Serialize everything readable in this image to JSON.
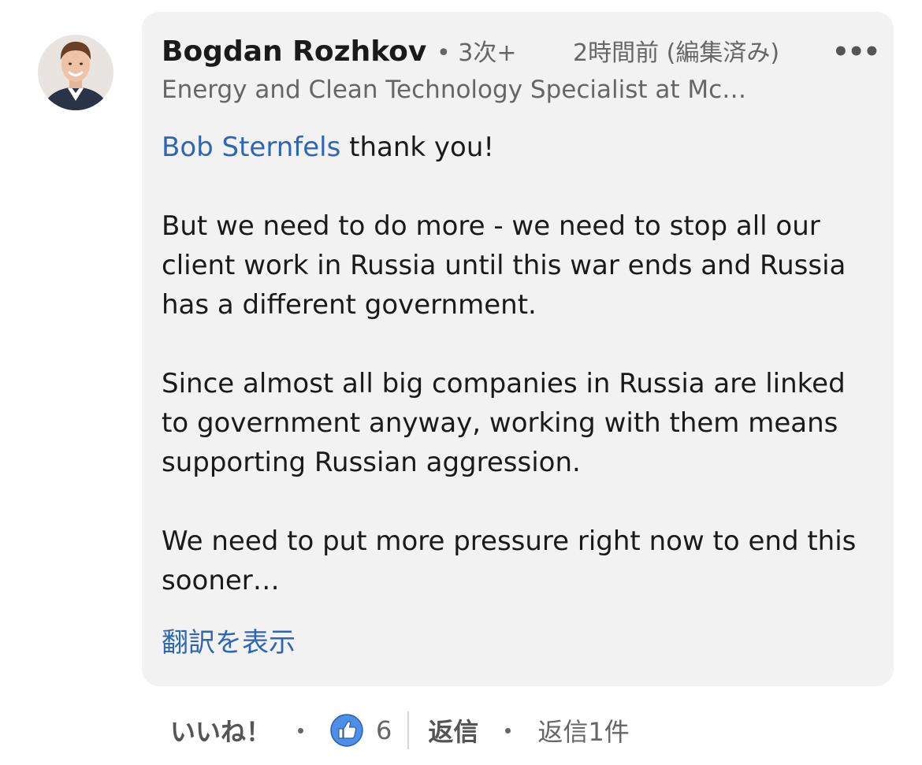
{
  "comment": {
    "author": {
      "name": "Bogdan Rozhkov",
      "connection": "• 3次+",
      "headline": "Energy and Clean Technology Specialist at Mc…"
    },
    "timestamp": "2時間前 (編集済み)",
    "more_label": "•••",
    "mention": "Bob Sternfels",
    "paragraphs": [
      " thank you!",
      "But we need to do more - we need to stop all our client work in Russia until this war ends and Russia has a different government.",
      "Since almost all big companies in Russia are linked to government anyway, working with them means supporting Russian aggression.",
      "We need to put more pressure right now to end this sooner…"
    ],
    "translate_label": "翻訳を表示"
  },
  "actions": {
    "like_label": "いいね！",
    "like_count": "6",
    "reply_label": "返信",
    "reply_count": "返信1件"
  },
  "colors": {
    "link": "#2e66b3",
    "bubble": "#f2f2f2",
    "like_icon": "#4d8ee8"
  },
  "icons": {
    "avatar": "profile-photo",
    "like": "thumbs-up-icon",
    "more": "more-options-icon"
  }
}
